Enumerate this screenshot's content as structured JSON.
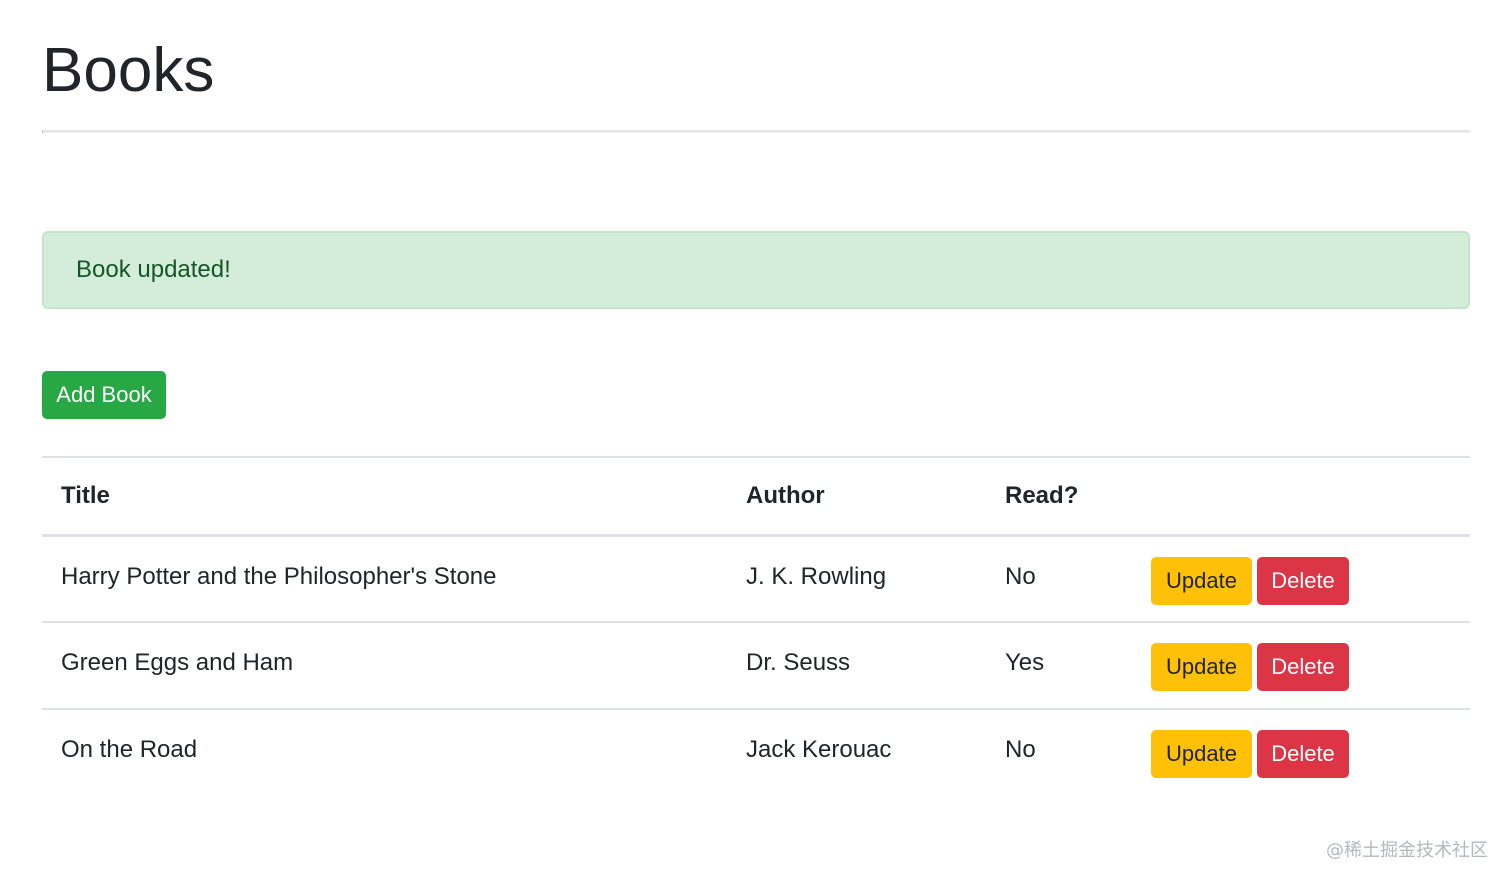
{
  "header": {
    "title": "Books"
  },
  "alert": {
    "message": "Book updated!"
  },
  "toolbar": {
    "add_label": "Add Book"
  },
  "table": {
    "columns": [
      "Title",
      "Author",
      "Read?",
      ""
    ],
    "rows": [
      {
        "title": "Harry Potter and the Philosopher's Stone",
        "author": "J. K. Rowling",
        "read": "No"
      },
      {
        "title": "Green Eggs and Ham",
        "author": "Dr. Seuss",
        "read": "Yes"
      },
      {
        "title": "On the Road",
        "author": "Jack Kerouac",
        "read": "No"
      }
    ],
    "update_label": "Update",
    "delete_label": "Delete"
  },
  "watermark": {
    "text": "@稀土掘金技术社区"
  },
  "colors": {
    "success": "#28a745",
    "warning": "#ffc107",
    "danger": "#dc3545",
    "alert_bg": "#d4edda",
    "alert_text": "#155724"
  }
}
